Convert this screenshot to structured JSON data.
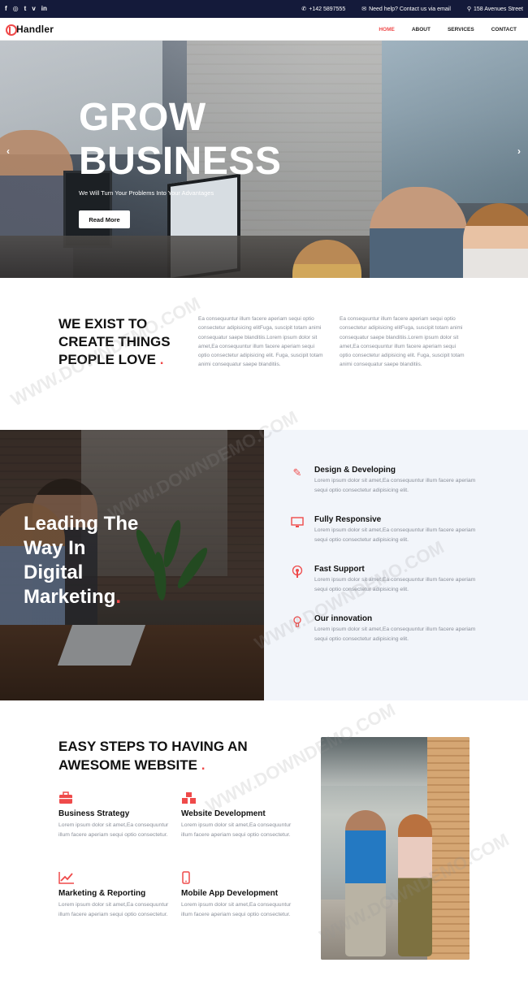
{
  "topbar": {
    "social": [
      "f",
      "◎",
      "t",
      "v",
      "in"
    ],
    "phone": "+142 5897555",
    "email": "Need help? Contact us via email",
    "address": "158 Avenues Street"
  },
  "nav": {
    "logo": "Handler",
    "items": [
      "HOME",
      "ABOUT",
      "SERVICES",
      "CONTACT"
    ]
  },
  "hero": {
    "title_line1": "GROW",
    "title_line2": "BUSINESS",
    "subtitle": "We Will Turn Your Problems Into Your Advantages",
    "button": "Read More",
    "prev": "‹",
    "next": "›"
  },
  "about": {
    "title_line1": "WE EXIST TO",
    "title_line2": "CREATE THINGS",
    "title_line3": "PEOPLE LOVE",
    "dot": ".",
    "col1": "Ea consequuntur illum facere aperiam sequi optio consectetur adipisicing elitFuga, suscipit totam animi consequatur saepe blanditiis.Lorem ipsum dolor sit amet,Ea consequuntur illum facere aperiam sequi optio consectetur adipisicing elit. Fuga, suscipit totam animi consequatur saepe blanditiis.",
    "col2": "Ea consequuntur illum facere aperiam sequi optio consectetur adipisicing elitFuga, suscipit totam animi consequatur saepe blanditiis.Lorem ipsum dolor sit amet,Ea consequuntur illum facere aperiam sequi optio consectetur adipisicing elit. Fuga, suscipit totam animi consequatur saepe blanditiis."
  },
  "services": {
    "title_line1": "Leading The",
    "title_line2": "Way In",
    "title_line3": "Digital",
    "title_line4": "Marketing",
    "dot": ".",
    "items": [
      {
        "icon": "pencil-icon",
        "title": "Design & Developing",
        "text": "Lorem ipsum dolor sit amet,Ea consequuntur illum facere aperiam sequi optio consectetur adipisicing elit."
      },
      {
        "icon": "monitor-icon",
        "title": "Fully Responsive",
        "text": "Lorem ipsum dolor sit amet,Ea consequuntur illum facere aperiam sequi optio consectetur adipisicing elit."
      },
      {
        "icon": "podcast-icon",
        "title": "Fast Support",
        "text": "Lorem ipsum dolor sit amet,Ea consequuntur illum facere aperiam sequi optio consectetur adipisicing elit."
      },
      {
        "icon": "lightbulb-icon",
        "title": "Our innovation",
        "text": "Lorem ipsum dolor sit amet,Ea consequuntur illum facere aperiam sequi optio consectetur adipisicing elit."
      }
    ]
  },
  "steps": {
    "title_line1": "EASY STEPS TO HAVING AN",
    "title_line2": "AWESOME WEBSITE",
    "dot": ".",
    "items": [
      {
        "icon": "briefcase-icon",
        "title": "Business Strategy",
        "text": "Lorem ipsum dolor sit amet,Ea consequuntur illum facere aperiam sequi optio consectetur."
      },
      {
        "icon": "cubes-icon",
        "title": "Website Development",
        "text": "Lorem ipsum dolor sit amet,Ea consequuntur illum facere aperiam sequi optio consectetur."
      },
      {
        "icon": "chart-line-icon",
        "title": "Marketing & Reporting",
        "text": "Lorem ipsum dolor sit amet,Ea consequuntur illum facere aperiam sequi optio consectetur."
      },
      {
        "icon": "mobile-icon",
        "title": "Mobile App Development",
        "text": "Lorem ipsum dolor sit amet,Ea consequuntur illum facere aperiam sequi optio consectetur."
      }
    ]
  },
  "watermark": "WWW.DOWNDEMO.COM",
  "colors": {
    "accent": "#ef4a4a",
    "topbar": "#141a3a",
    "muted": "#8a8f99"
  }
}
